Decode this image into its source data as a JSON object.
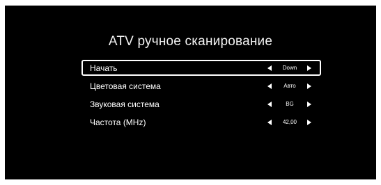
{
  "screen": {
    "title": "ATV ручное сканирование"
  },
  "menu": {
    "items": [
      {
        "label": "Начать",
        "value": "Down",
        "selected": true
      },
      {
        "label": "Цветовая система",
        "value": "Авто",
        "selected": false
      },
      {
        "label": "Звуковая система",
        "value": "BG",
        "selected": false
      },
      {
        "label": "Частота (MHz)",
        "value": "42,00",
        "selected": false
      }
    ],
    "left_arrow_icon": "triangle-left",
    "right_arrow_icon": "triangle-right"
  },
  "colors": {
    "background": "#000000",
    "text": "#ffffff",
    "selection_border": "#ffffff"
  }
}
